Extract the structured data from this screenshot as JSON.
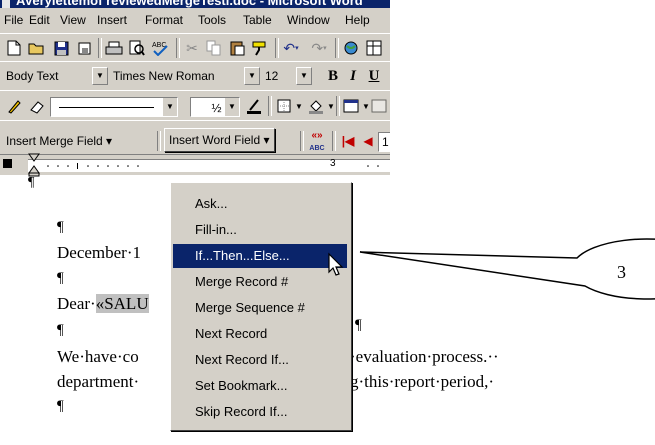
{
  "window": {
    "title": "AVerylettemof reviewedMergeTestl.doc - Microsoft Word"
  },
  "menu": [
    "File",
    "Edit",
    "View",
    "Insert",
    "Format",
    "Tools",
    "Table",
    "Window",
    "Help"
  ],
  "formatting": {
    "style": "Body Text",
    "font": "Times New Roman",
    "size": "12",
    "bold": "B",
    "italic": "I",
    "underline": "U"
  },
  "drawing": {
    "line_weight": "½"
  },
  "mail_merge": {
    "insert_merge_field": "Insert Merge Field ▾",
    "insert_word_field": "Insert Word Field ▾",
    "view_merged": "«»",
    "view_merged_sub": "ABC",
    "record_number": "1"
  },
  "ruler": {
    "marker": "3"
  },
  "dropdown": {
    "items": [
      "Ask...",
      "Fill-in...",
      "If...Then...Else...",
      "Merge Record #",
      "Merge Sequence #",
      "Next Record",
      "Next Record If...",
      "Set Bookmark...",
      "Skip Record If..."
    ],
    "selected_index": 2
  },
  "document": {
    "pilcrow": "¶",
    "date_line": "December·1",
    "dear_prefix": "Dear·",
    "salutation_field": "«SALU",
    "para1_left": "We·have·co",
    "para1_right": "·evaluation·process.··",
    "para2_left": "department·",
    "para2_right": "g·this·report·period,·"
  },
  "callout": {
    "label": "3"
  },
  "colors": {
    "selection": "#0a246a",
    "chrome": "#d4d0c8"
  }
}
